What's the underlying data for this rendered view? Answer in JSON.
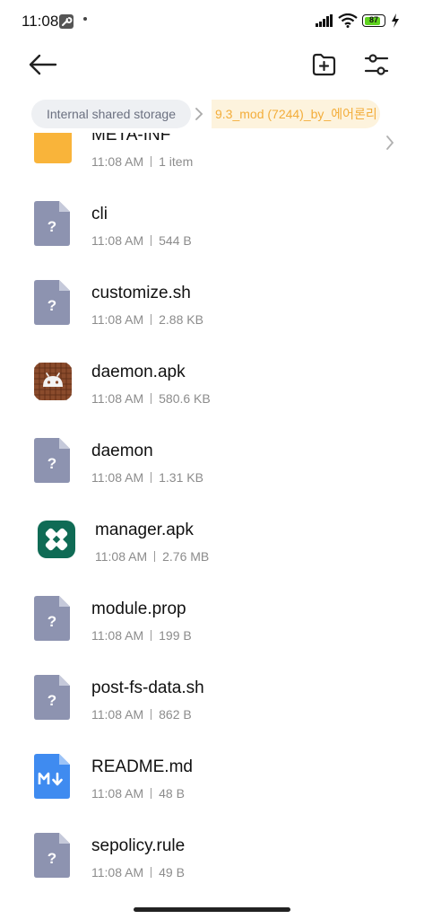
{
  "status_bar": {
    "time": "11:08",
    "battery_level": "87",
    "icons": [
      "wrench-icon",
      "signal-icon",
      "wifi-icon",
      "battery-icon",
      "charging-bolt-icon"
    ]
  },
  "toolbar": {
    "back_icon": "arrow-left-icon",
    "new_folder_icon": "folder-plus-icon",
    "filter_icon": "sliders-icon"
  },
  "breadcrumb": {
    "root": "Internal shared storage",
    "current": "9.3_mod (7244)_by_에어론리"
  },
  "colors": {
    "breadcrumb_current_text": "#f3ad3a",
    "breadcrumb_current_bg": "#fdf3dd",
    "folder_yellow": "#f9b43a",
    "unknown_file": "#8d93b0",
    "markdown_blue": "#3f8bf0",
    "manager_green": "#0f6b55",
    "daemon_brown": "#8a4b2c"
  },
  "files": [
    {
      "name": "META-INF",
      "time": "11:08 AM",
      "detail": "1 item",
      "icon": "folder-icon",
      "has_chevron": true
    },
    {
      "name": "cli",
      "time": "11:08 AM",
      "detail": "544 B",
      "icon": "unknown-file-icon"
    },
    {
      "name": "customize.sh",
      "time": "11:08 AM",
      "detail": "2.88 KB",
      "icon": "unknown-file-icon"
    },
    {
      "name": "daemon.apk",
      "time": "11:08 AM",
      "detail": "580.6 KB",
      "icon": "android-apk-icon"
    },
    {
      "name": "daemon",
      "time": "11:08 AM",
      "detail": "1.31 KB",
      "icon": "unknown-file-icon"
    },
    {
      "name": "manager.apk",
      "time": "11:08 AM",
      "detail": "2.76 MB",
      "icon": "manager-app-icon"
    },
    {
      "name": "module.prop",
      "time": "11:08 AM",
      "detail": "199 B",
      "icon": "unknown-file-icon"
    },
    {
      "name": "post-fs-data.sh",
      "time": "11:08 AM",
      "detail": "862 B",
      "icon": "unknown-file-icon"
    },
    {
      "name": "README.md",
      "time": "11:08 AM",
      "detail": "48 B",
      "icon": "markdown-file-icon"
    },
    {
      "name": "sepolicy.rule",
      "time": "11:08 AM",
      "detail": "49 B",
      "icon": "unknown-file-icon"
    }
  ]
}
